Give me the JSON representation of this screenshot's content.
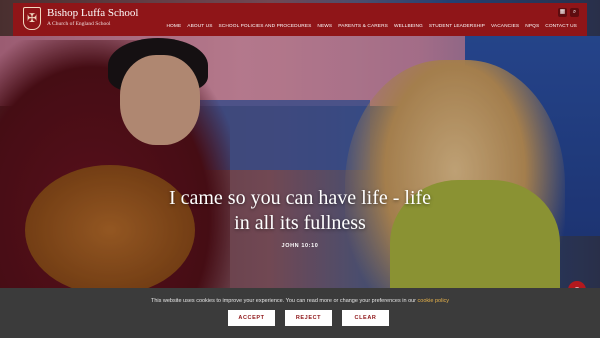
{
  "header": {
    "school_name": "Bishop Luffa School",
    "school_subtitle": "A Church of England School",
    "crest_icon": "crest-icon",
    "brand_color": "#8f1518"
  },
  "top_icons": [
    "calendar-icon",
    "search-icon"
  ],
  "nav": [
    "HOME",
    "ABOUT US",
    "SCHOOL POLICIES AND PROCEDURES",
    "NEWS",
    "PARENTS & CARERS",
    "WELLBEING",
    "STUDENT LEADERSHIP",
    "VACANCIES",
    "NPQS",
    "CONTACT US"
  ],
  "hero": {
    "quote": "I came so you can have life - life in all its fullness",
    "citation": "JOHN 10:10"
  },
  "cookie": {
    "text": "This website uses cookies to improve your experience. You can read more or change your preferences in our",
    "link": "cookie policy",
    "accept": "ACCEPT",
    "reject": "REJECT",
    "clear": "CLEAR"
  }
}
